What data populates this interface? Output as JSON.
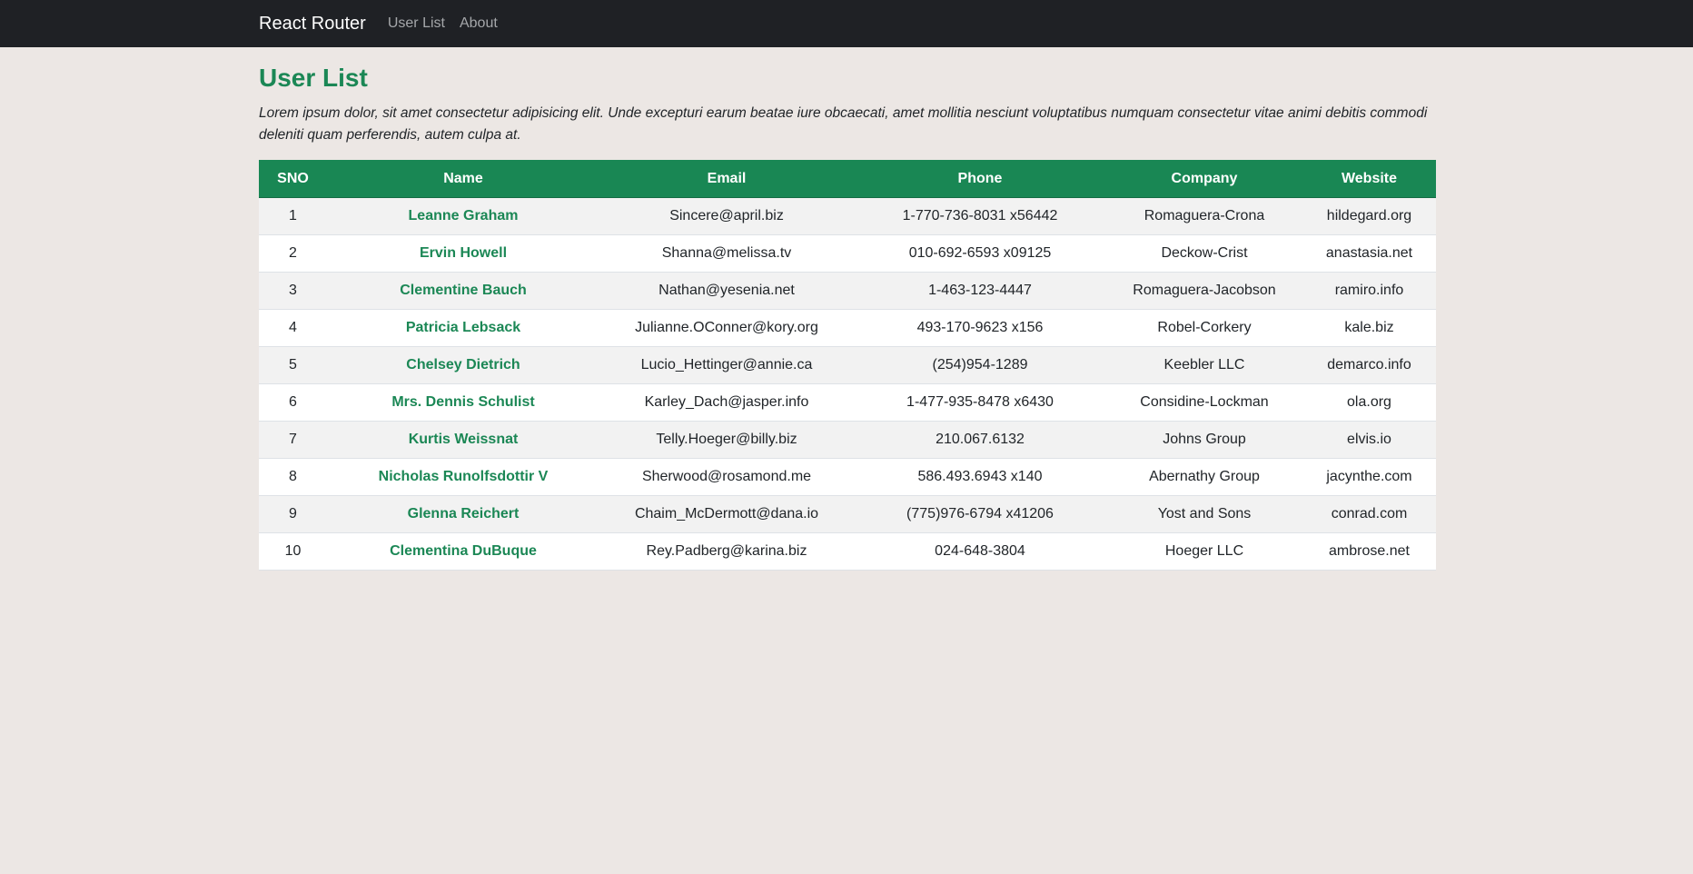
{
  "navbar": {
    "brand": "React Router",
    "links": [
      "User List",
      "About"
    ]
  },
  "page": {
    "title": "User List",
    "intro": "Lorem ipsum dolor, sit amet consectetur adipisicing elit. Unde excepturi earum beatae iure obcaecati, amet mollitia nesciunt voluptatibus numquam consectetur vitae animi debitis commodi deleniti quam perferendis, autem culpa at."
  },
  "table": {
    "headers": [
      "SNO",
      "Name",
      "Email",
      "Phone",
      "Company",
      "Website"
    ],
    "rows": [
      [
        "1",
        "Leanne Graham",
        "Sincere@april.biz",
        "1-770-736-8031 x56442",
        "Romaguera-Crona",
        "hildegard.org"
      ],
      [
        "2",
        "Ervin Howell",
        "Shanna@melissa.tv",
        "010-692-6593 x09125",
        "Deckow-Crist",
        "anastasia.net"
      ],
      [
        "3",
        "Clementine Bauch",
        "Nathan@yesenia.net",
        "1-463-123-4447",
        "Romaguera-Jacobson",
        "ramiro.info"
      ],
      [
        "4",
        "Patricia Lebsack",
        "Julianne.OConner@kory.org",
        "493-170-9623 x156",
        "Robel-Corkery",
        "kale.biz"
      ],
      [
        "5",
        "Chelsey Dietrich",
        "Lucio_Hettinger@annie.ca",
        "(254)954-1289",
        "Keebler LLC",
        "demarco.info"
      ],
      [
        "6",
        "Mrs. Dennis Schulist",
        "Karley_Dach@jasper.info",
        "1-477-935-8478 x6430",
        "Considine-Lockman",
        "ola.org"
      ],
      [
        "7",
        "Kurtis Weissnat",
        "Telly.Hoeger@billy.biz",
        "210.067.6132",
        "Johns Group",
        "elvis.io"
      ],
      [
        "8",
        "Nicholas Runolfsdottir V",
        "Sherwood@rosamond.me",
        "586.493.6943 x140",
        "Abernathy Group",
        "jacynthe.com"
      ],
      [
        "9",
        "Glenna Reichert",
        "Chaim_McDermott@dana.io",
        "(775)976-6794 x41206",
        "Yost and Sons",
        "conrad.com"
      ],
      [
        "10",
        "Clementina DuBuque",
        "Rey.Padberg@karina.biz",
        "024-648-3804",
        "Hoeger LLC",
        "ambrose.net"
      ]
    ]
  },
  "colors": {
    "navbar_bg": "#1f2125",
    "accent": "#198754",
    "page_bg": "#ece7e4"
  }
}
